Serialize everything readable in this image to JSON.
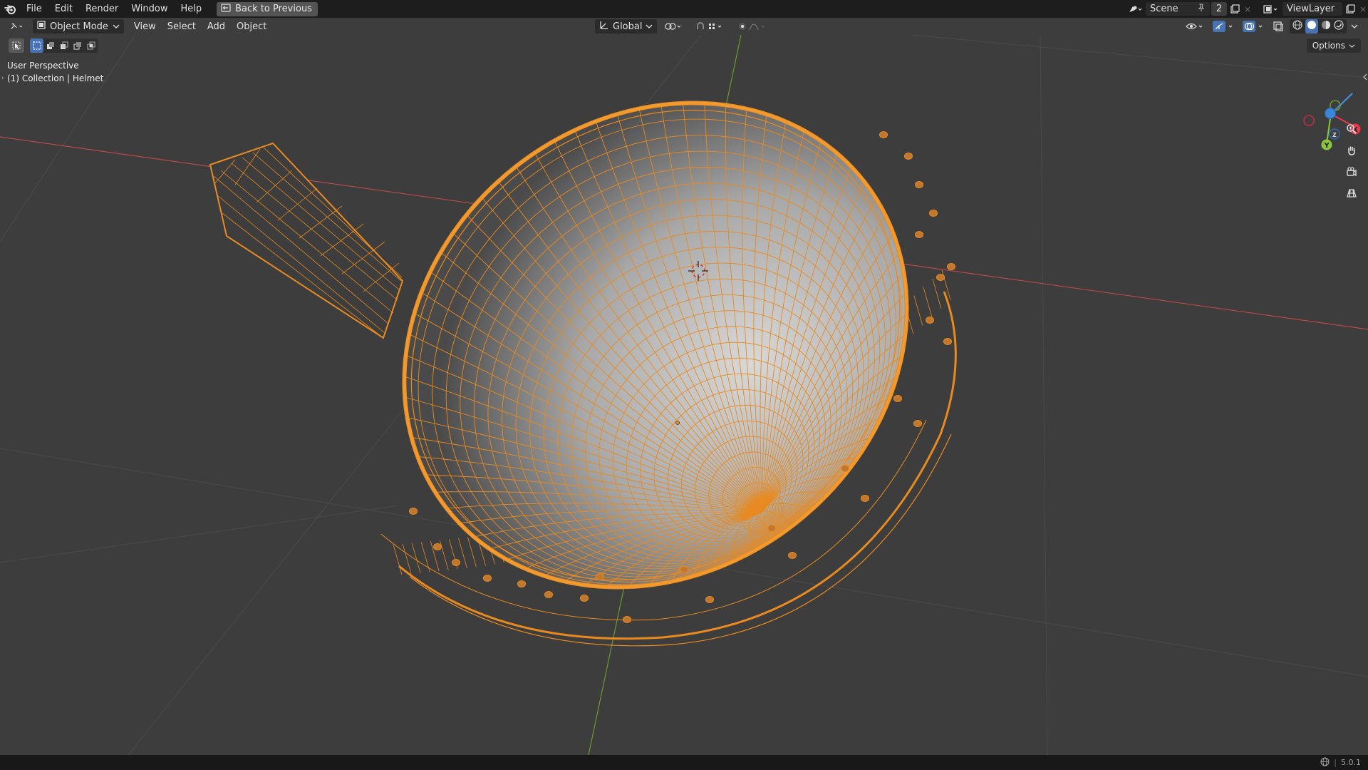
{
  "topbar": {
    "menu": [
      "File",
      "Edit",
      "Render",
      "Window",
      "Help"
    ],
    "back_button": "Back to Previous",
    "scene_name": "Scene",
    "scene_users": "2",
    "view_layer": "ViewLayer"
  },
  "viewport_header": {
    "mode": "Object Mode",
    "menus": [
      "View",
      "Select",
      "Add",
      "Object"
    ],
    "transform_orientation": "Global"
  },
  "overlay": {
    "perspective_label": "User Perspective",
    "collection_label": "(1) Collection | Helmet",
    "options_label": "Options"
  },
  "gizmo": {
    "x_label": "X",
    "y_label": "Y",
    "z_label": "Z",
    "x_color": "#e8394d",
    "y_color": "#8cc63f",
    "z_color": "#3c86d9"
  },
  "statusbar": {
    "version": "5.0.1"
  },
  "colors": {
    "selection": "#e88a20",
    "x_axis": "#b84a4a",
    "y_axis": "#6a9a2c",
    "background": "#3d3d3d"
  },
  "icons": [
    "blender-logo",
    "back-icon",
    "scene-icon",
    "pin-icon",
    "new-scene-icon",
    "viewlayer-icon",
    "editor-type-icon",
    "object-mode-icon",
    "orientation-icon",
    "snap-icon",
    "proportional-icon",
    "visibility-icon",
    "gizmo-icon",
    "overlay-icon",
    "xray-icon",
    "wireframe-shading-icon",
    "solid-shading-icon",
    "material-shading-icon",
    "rendered-shading-icon",
    "zoom-icon",
    "pan-hand-icon",
    "camera-icon",
    "grid-view-icon",
    "select-tool-icon",
    "globe-icon"
  ]
}
